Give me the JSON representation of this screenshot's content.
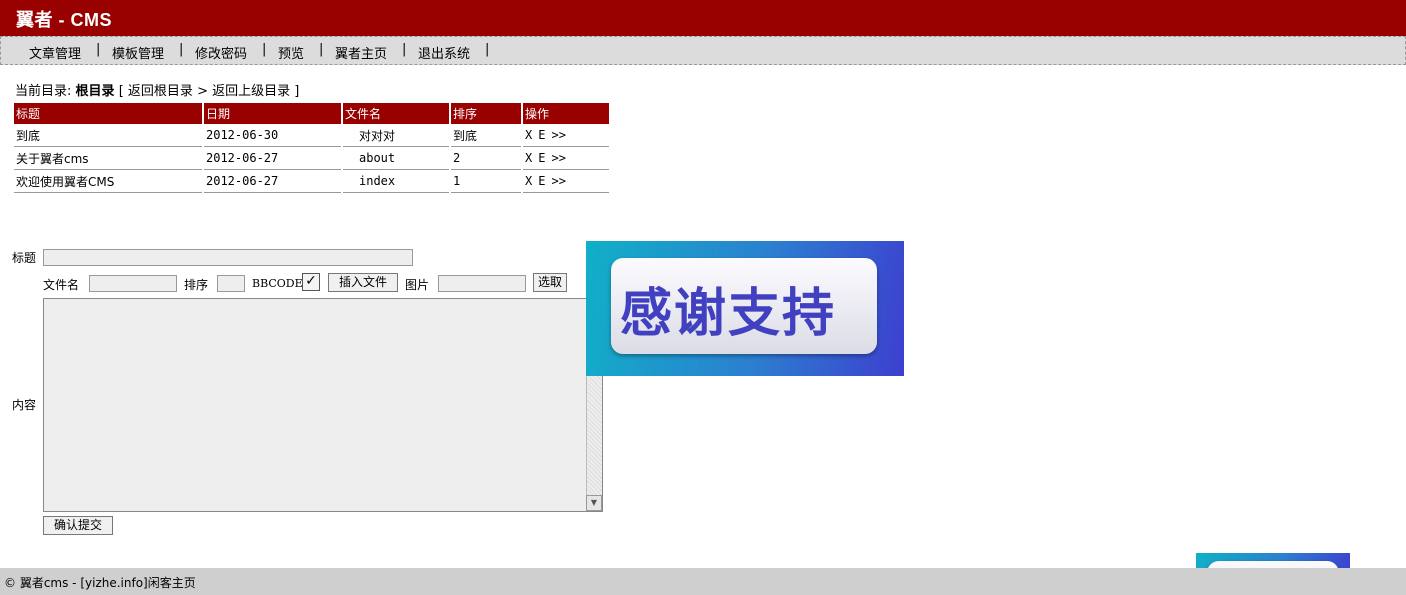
{
  "header": {
    "title": "翼者 - CMS"
  },
  "nav": {
    "items": [
      "文章管理",
      "模板管理",
      "修改密码",
      "预览",
      "翼者主页",
      "退出系统"
    ],
    "separator": "|"
  },
  "breadcrumb": {
    "prefix": "当前目录:",
    "current": "根目录",
    "open": "[",
    "back_root": "返回根目录",
    "back_up": "> 返回上级目录",
    "close": "]"
  },
  "table": {
    "headers": [
      "标题",
      "日期",
      "文件名",
      "排序",
      "操作"
    ],
    "rows": [
      {
        "title": "到底",
        "date": "2012-06-30",
        "file": "对对对",
        "order": "到底"
      },
      {
        "title": "关于翼者cms",
        "date": "2012-06-27",
        "file": "about",
        "order": "2"
      },
      {
        "title": "欢迎使用翼者CMS",
        "date": "2012-06-27",
        "file": "index",
        "order": "1"
      }
    ],
    "actions": {
      "delete": "X",
      "edit": "E",
      "more": ">>"
    }
  },
  "form": {
    "title_label": "标题",
    "title_value": "",
    "filename_label": "文件名",
    "filename_value": "",
    "order_label": "排序",
    "order_value": "",
    "bbcode_label": "BBCODE",
    "bbcode_checked": true,
    "checkmark": "✓",
    "insert_file_button": "插入文件",
    "image_label": "图片",
    "image_value": "",
    "select_button": "选取",
    "content_label": "内容",
    "content_value": "",
    "submit_button": "确认提交"
  },
  "banner": {
    "text": "感谢支持"
  },
  "footer": {
    "copyright": "© 翼者cms - ",
    "link": "[yizhe.info]",
    "home": "闲客主页"
  }
}
